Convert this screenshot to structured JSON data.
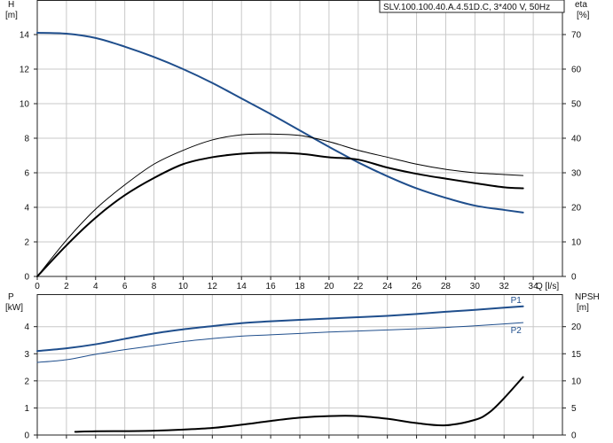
{
  "title": "SLV.100.100.40.A.4.51D.C, 3*400 V, 50Hz",
  "chart_data": [
    {
      "type": "line",
      "name": "head-efficiency",
      "x": [
        0,
        2,
        4,
        6,
        8,
        10,
        12,
        14,
        16,
        18,
        20,
        22,
        24,
        26,
        28,
        30,
        32,
        33.3
      ],
      "xlim": [
        0,
        36
      ],
      "xticks": [
        0,
        2,
        4,
        6,
        8,
        10,
        12,
        14,
        16,
        18,
        20,
        22,
        24,
        26,
        28,
        30,
        32,
        34
      ],
      "xlabel": "Q [l/s]",
      "ylim": [
        0,
        16
      ],
      "yticks": [
        0,
        2,
        4,
        6,
        8,
        10,
        12,
        14
      ],
      "ylabel": "H",
      "ylabel_unit": "[m]",
      "y2lim": [
        0,
        80
      ],
      "y2ticks": [
        0,
        10,
        20,
        30,
        40,
        50,
        60,
        70
      ],
      "y2label": "eta",
      "y2label_unit": "[%]",
      "grid": true,
      "series": [
        {
          "axis": "left",
          "color": "#1f4e8c",
          "width": 2,
          "values": [
            14.1,
            14.05,
            13.8,
            13.3,
            12.7,
            12.0,
            11.2,
            10.3,
            9.4,
            8.45,
            7.5,
            6.6,
            5.8,
            5.1,
            4.55,
            4.1,
            3.85,
            3.7
          ]
        },
        {
          "axis": "right",
          "color": "#000000",
          "width": 1,
          "values": [
            0,
            10.5,
            19.5,
            26.5,
            32.5,
            36.5,
            39.5,
            41.0,
            41.2,
            40.8,
            39.0,
            36.5,
            34.5,
            32.5,
            31.0,
            30.0,
            29.5,
            29.2
          ]
        },
        {
          "axis": "right",
          "color": "#000000",
          "width": 2,
          "values": [
            0,
            9.0,
            17.0,
            23.5,
            28.5,
            32.5,
            34.5,
            35.5,
            35.8,
            35.5,
            34.5,
            33.8,
            31.5,
            29.7,
            28.3,
            27.0,
            25.8,
            25.5
          ]
        }
      ]
    },
    {
      "type": "line",
      "name": "power-npsh",
      "x": [
        0,
        2,
        4,
        6,
        8,
        10,
        12,
        14,
        16,
        18,
        20,
        22,
        24,
        26,
        28,
        30,
        32,
        33.3
      ],
      "xlim": [
        0,
        36
      ],
      "ylim": [
        0,
        5.2
      ],
      "yticks": [
        0,
        1,
        2,
        3,
        4
      ],
      "ylabel": "P",
      "ylabel_unit": "[kW]",
      "y2lim": [
        0,
        26
      ],
      "y2ticks": [
        0,
        5,
        10,
        15,
        20
      ],
      "y2label": "NPSH",
      "y2label_unit": "[m]",
      "grid": true,
      "series": [
        {
          "name": "P1",
          "axis": "left",
          "color": "#1f4e8c",
          "width": 2,
          "values": [
            3.1,
            3.2,
            3.35,
            3.55,
            3.75,
            3.9,
            4.02,
            4.13,
            4.2,
            4.25,
            4.3,
            4.35,
            4.4,
            4.47,
            4.55,
            4.62,
            4.7,
            4.75
          ]
        },
        {
          "name": "P2",
          "axis": "left",
          "color": "#1f4e8c",
          "width": 1,
          "values": [
            2.68,
            2.78,
            2.98,
            3.15,
            3.3,
            3.45,
            3.56,
            3.65,
            3.7,
            3.75,
            3.8,
            3.84,
            3.88,
            3.92,
            3.97,
            4.03,
            4.1,
            4.15
          ]
        }
      ],
      "npsh_curve": {
        "axis": "right",
        "color": "#000000",
        "width": 2,
        "x": [
          2.6,
          4,
          6,
          8,
          10,
          12,
          14,
          16,
          18,
          20,
          22,
          24,
          26,
          28,
          30,
          31,
          32,
          33.3
        ],
        "values": [
          0.6,
          0.7,
          0.72,
          0.8,
          1.0,
          1.3,
          1.9,
          2.6,
          3.2,
          3.5,
          3.5,
          3.0,
          2.2,
          1.8,
          2.8,
          4.2,
          6.8,
          10.7
        ]
      }
    }
  ]
}
